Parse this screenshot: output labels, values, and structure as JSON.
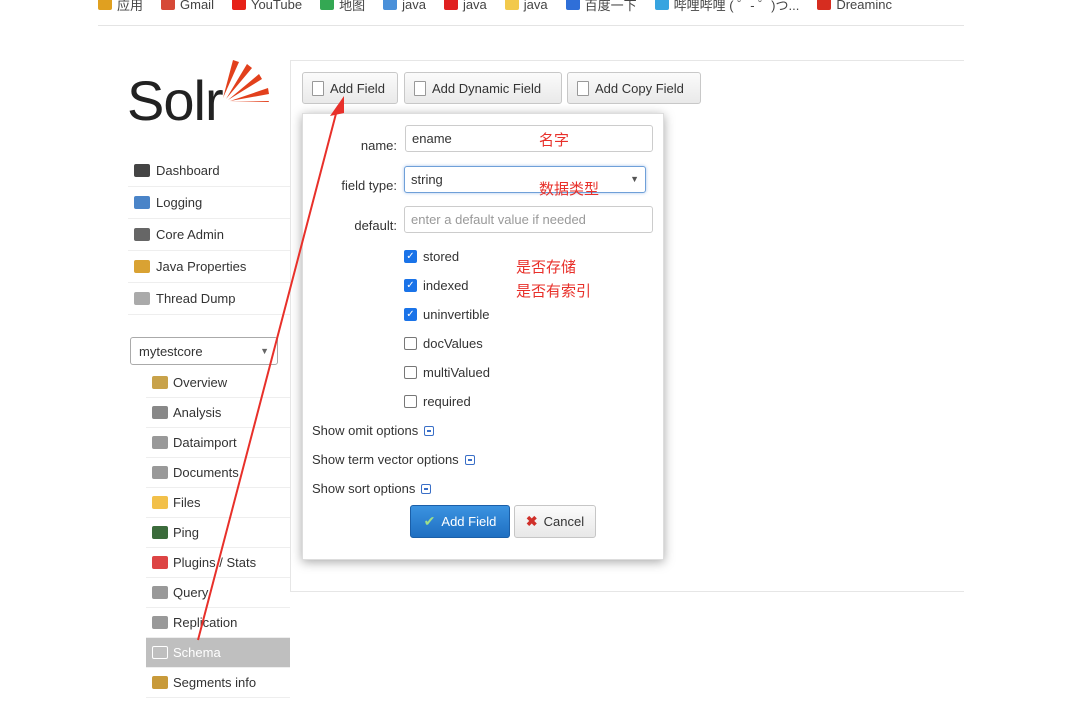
{
  "bookmarks": [
    {
      "label": "应用",
      "color": "#e0a020"
    },
    {
      "label": "Gmail",
      "color": "#d64937"
    },
    {
      "label": "YouTube",
      "color": "#e62117"
    },
    {
      "label": "地图",
      "color": "#34a853"
    },
    {
      "label": "java",
      "color": "#4a90d9"
    },
    {
      "label": "java",
      "color": "#e02020"
    },
    {
      "label": "java",
      "color": "#f2c94c"
    },
    {
      "label": "百度一下",
      "color": "#2f6fd8"
    },
    {
      "label": "哔哩哔哩 ( ゜- ゜)つ...",
      "color": "#37a4e0"
    },
    {
      "label": "Dreaminc",
      "color": "#d62d20"
    }
  ],
  "logo": {
    "text": "Solr",
    "accent": "#e2401c"
  },
  "nav": {
    "items": [
      {
        "label": "Dashboard",
        "icon": "dashboard-icon",
        "color": "#444"
      },
      {
        "label": "Logging",
        "icon": "logging-icon",
        "color": "#4a84c8"
      },
      {
        "label": "Core Admin",
        "icon": "core-admin-icon",
        "color": "#666"
      },
      {
        "label": "Java Properties",
        "icon": "java-properties-icon",
        "color": "#d9a233"
      },
      {
        "label": "Thread Dump",
        "icon": "thread-dump-icon",
        "color": "#aaa"
      }
    ],
    "core_selector": "mytestcore",
    "core_items": [
      {
        "label": "Overview",
        "icon": "overview-icon",
        "color": "#c8a24a"
      },
      {
        "label": "Analysis",
        "icon": "analysis-icon",
        "color": "#888"
      },
      {
        "label": "Dataimport",
        "icon": "dataimport-icon",
        "color": "#999"
      },
      {
        "label": "Documents",
        "icon": "documents-icon",
        "color": "#999"
      },
      {
        "label": "Files",
        "icon": "files-icon",
        "color": "#f2c04a"
      },
      {
        "label": "Ping",
        "icon": "ping-icon",
        "color": "#3b6b3b"
      },
      {
        "label": "Plugins / Stats",
        "icon": "plugins-icon",
        "color": "#d44"
      },
      {
        "label": "Query",
        "icon": "query-icon",
        "color": "#999"
      },
      {
        "label": "Replication",
        "icon": "replication-icon",
        "color": "#999"
      },
      {
        "label": "Schema",
        "icon": "schema-icon",
        "color": "#fff",
        "active": true
      },
      {
        "label": "Segments info",
        "icon": "segments-icon",
        "color": "#c89a3a"
      }
    ]
  },
  "toolbar": {
    "add_field": "Add Field",
    "add_dynamic_field": "Add Dynamic Field",
    "add_copy_field": "Add Copy Field"
  },
  "form": {
    "name_label": "name:",
    "name_value": "ename",
    "field_type_label": "field type:",
    "field_type_value": "string",
    "default_label": "default:",
    "default_placeholder": "enter a default value if needed",
    "checkboxes": [
      {
        "label": "stored",
        "checked": true
      },
      {
        "label": "indexed",
        "checked": true
      },
      {
        "label": "uninvertible",
        "checked": true
      },
      {
        "label": "docValues",
        "checked": false
      },
      {
        "label": "multiValued",
        "checked": false
      },
      {
        "label": "required",
        "checked": false
      }
    ],
    "show_omit": "Show omit options",
    "show_term_vector": "Show term vector options",
    "show_sort": "Show sort options",
    "submit": "Add Field",
    "cancel": "Cancel"
  },
  "annotations": {
    "name_note": "名字",
    "type_note": "数据类型",
    "stored_note": "是否存储",
    "indexed_note": "是否有索引",
    "color": "#e8302a"
  }
}
